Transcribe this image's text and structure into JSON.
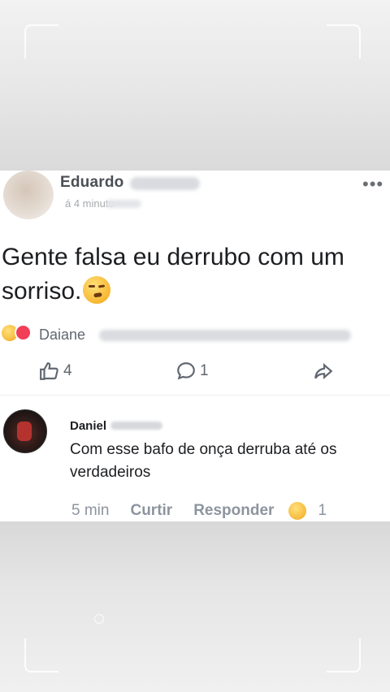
{
  "post": {
    "author_first": "Eduardo",
    "time": "á 4 minuto",
    "text": "Gente falsa eu derrubo com um sorriso.",
    "more_icon": "more-options-icon",
    "reactions": {
      "icons": [
        "haha-reaction-icon",
        "love-reaction-icon"
      ],
      "name": "Daiane"
    },
    "actions": {
      "like_count": "4",
      "comment_count": "1",
      "share_icon": "share-icon"
    }
  },
  "comment": {
    "author_first": "Daniel",
    "text": "Com esse bafo de onça derruba até os verdadeiros",
    "time": "5 min",
    "like_label": "Curtir",
    "reply_label": "Responder",
    "reaction_count": "1"
  }
}
